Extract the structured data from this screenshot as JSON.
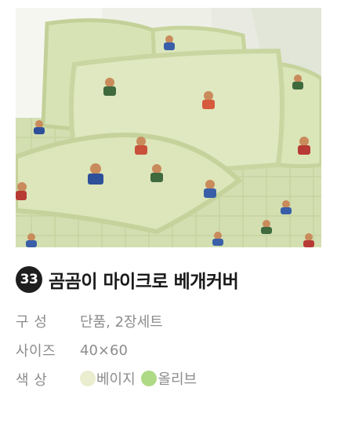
{
  "product": {
    "number": "33",
    "title": "곰곰이 마이크로 베개커버",
    "image_alt": "product-photo"
  },
  "specs": {
    "composition": {
      "label": "구 성",
      "value": "단품, 2장세트"
    },
    "size": {
      "label": "사이즈",
      "value": "40×60"
    },
    "color": {
      "label": "색 상",
      "options": [
        {
          "name": "베이지",
          "swatch": "#ebedcf"
        },
        {
          "name": "올리브",
          "swatch": "#aed985"
        }
      ]
    }
  },
  "colors": {
    "pillow": "#d9e4b8",
    "pillow_border": "#c9d7a3",
    "background": "#f0f1ea"
  }
}
